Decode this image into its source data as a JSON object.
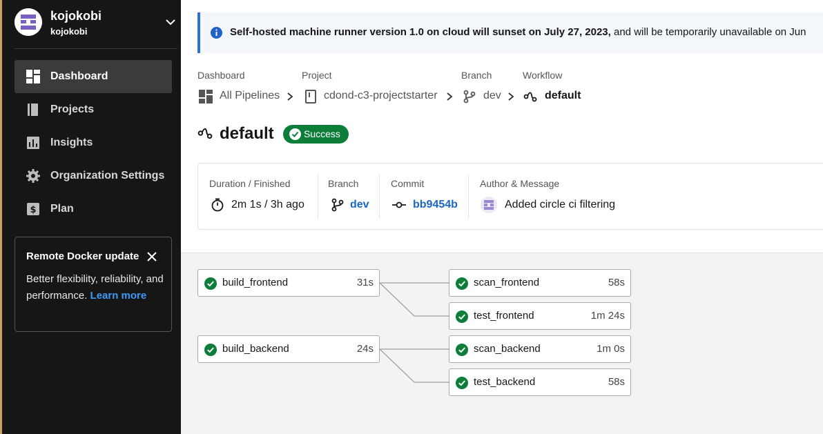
{
  "org": {
    "name": "kojokobi",
    "sub": "kojokobi"
  },
  "nav": [
    {
      "label": "Dashboard",
      "icon": "dashboard-icon",
      "active": true
    },
    {
      "label": "Projects",
      "icon": "book-icon"
    },
    {
      "label": "Insights",
      "icon": "chart-icon"
    },
    {
      "label": "Organization Settings",
      "icon": "gear-icon"
    },
    {
      "label": "Plan",
      "icon": "dollar-icon"
    }
  ],
  "promo": {
    "title": "Remote Docker update",
    "body": "Better flexibility, reliability, and performance.",
    "link": "Learn more"
  },
  "banner": {
    "bold": "Self-hosted machine runner version 1.0 on cloud will sunset on July 27, 2023,",
    "rest": " and will be temporarily unavailable on Jun"
  },
  "breadcrumb": {
    "heads": [
      "Dashboard",
      "Project",
      "Branch",
      "Workflow"
    ],
    "values": [
      "All Pipelines",
      "cdond-c3-projectstarter",
      "dev",
      "default"
    ]
  },
  "workflow": {
    "title": "default",
    "status": "Success"
  },
  "meta": {
    "duration_head": "Duration / Finished",
    "duration": "2m 1s / 3h ago",
    "branch_head": "Branch",
    "branch": "dev",
    "commit_head": "Commit",
    "commit": "bb9454b",
    "author_head": "Author & Message",
    "message": "Added circle ci filtering"
  },
  "jobs": [
    {
      "name": "build_frontend",
      "duration": "31s"
    },
    {
      "name": "scan_frontend",
      "duration": "58s"
    },
    {
      "name": "test_frontend",
      "duration": "1m 24s"
    },
    {
      "name": "build_backend",
      "duration": "24s"
    },
    {
      "name": "scan_backend",
      "duration": "1m 0s"
    },
    {
      "name": "test_backend",
      "duration": "58s"
    }
  ],
  "colors": {
    "success": "#0d7d3a",
    "link": "#1a66c4",
    "sidebar": "#161616",
    "banner_accent": "#2e6fd1"
  }
}
